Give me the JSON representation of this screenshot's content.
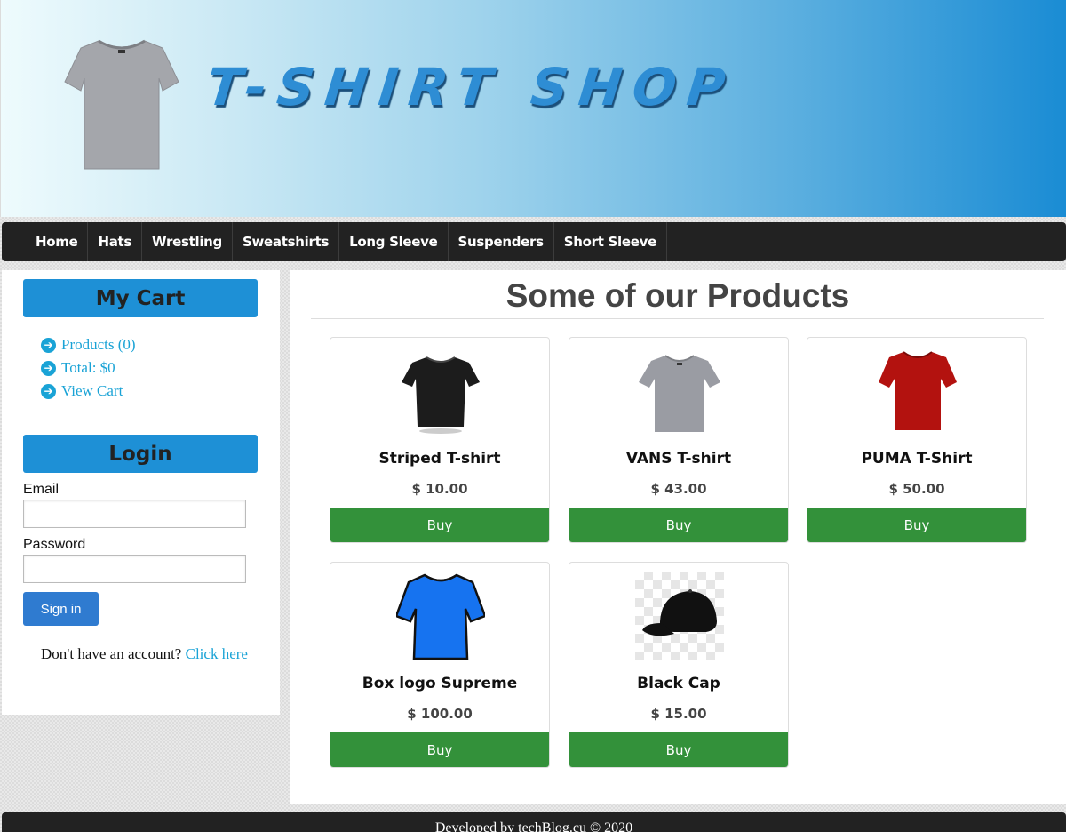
{
  "header": {
    "logo_text": "T-SHIRT SHOP"
  },
  "nav": {
    "items": [
      "Home",
      "Hats",
      "Wrestling",
      "Sweatshirts",
      "Long Sleeve",
      "Suspenders",
      "Short Sleeve"
    ]
  },
  "cart": {
    "title": "My Cart",
    "products": "Products (0)",
    "total": "Total: $0",
    "view": "View Cart"
  },
  "login": {
    "title": "Login",
    "email_label": "Email",
    "email_value": "",
    "password_label": "Password",
    "password_value": "",
    "signin_label": "Sign in",
    "no_account": "Don't have an account?",
    "click_here": " Click here"
  },
  "main": {
    "title": "Some of our Products",
    "buy_label": "Buy",
    "products": [
      {
        "name": "Striped T-shirt",
        "price": "$ 10.00",
        "color": "#1c1c1c"
      },
      {
        "name": "VANS T-shirt",
        "price": "$ 43.00",
        "color": "#9a9ca3"
      },
      {
        "name": "PUMA T-Shirt",
        "price": "$ 50.00",
        "color": "#b3120f"
      },
      {
        "name": "Box logo Supreme",
        "price": "$ 100.00",
        "color": "#1673f0"
      },
      {
        "name": "Black Cap",
        "price": "$ 15.00",
        "color": "#111111"
      }
    ]
  },
  "footer": {
    "text": "Developed by techBlog.cu © 2020"
  }
}
